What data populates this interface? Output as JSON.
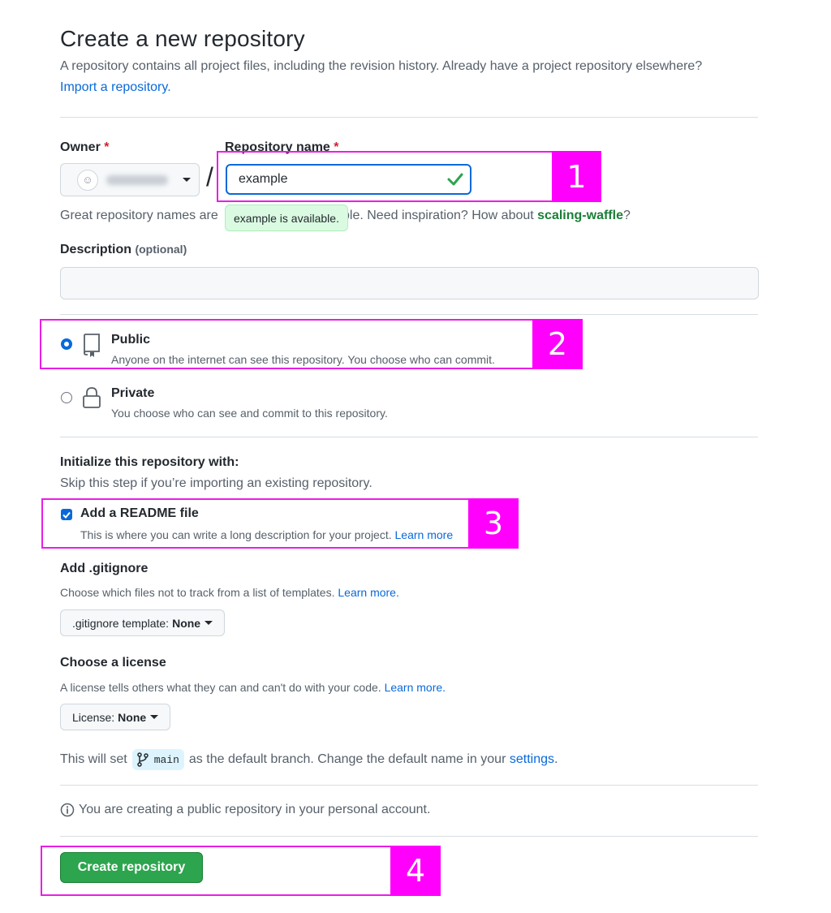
{
  "page": {
    "title": "Create a new repository",
    "subtitle": "A repository contains all project files, including the revision history. Already have a project repository elsewhere?",
    "import_link": "Import a repository."
  },
  "owner": {
    "label": "Owner",
    "required_mark": "*"
  },
  "repo_name": {
    "label": "Repository name",
    "required_mark": "*",
    "value": "example",
    "available_tooltip": "example is available.",
    "separator": "/"
  },
  "hint": {
    "prefix": "Great repository names are",
    "middle": "ple. Need inspiration? How about",
    "suggestion": "scaling-waffle",
    "suffix": "?"
  },
  "description": {
    "label": "Description",
    "optional": "(optional)",
    "value": ""
  },
  "visibility": {
    "public": {
      "title": "Public",
      "desc": "Anyone on the internet can see this repository. You choose who can commit.",
      "selected": true
    },
    "private": {
      "title": "Private",
      "desc": "You choose who can see and commit to this repository.",
      "selected": false
    }
  },
  "init": {
    "title": "Initialize this repository with:",
    "subtitle": "Skip this step if you’re importing an existing repository.",
    "readme": {
      "label": "Add a README file",
      "desc": "This is where you can write a long description for your project.",
      "link": "Learn more",
      "checked": true
    }
  },
  "gitignore": {
    "title": "Add .gitignore",
    "desc": "Choose which files not to track from a list of templates.",
    "link": "Learn more.",
    "button_prefix": ".gitignore template:",
    "button_value": "None"
  },
  "license": {
    "title": "Choose a license",
    "desc": "A license tells others what they can and can't do with your code.",
    "link": "Learn more.",
    "button_prefix": "License:",
    "button_value": "None"
  },
  "branch": {
    "prefix": "This will set",
    "name": "main",
    "middle": "as the default branch. Change the default name in your",
    "link": "settings",
    "suffix": "."
  },
  "info": {
    "text": "You are creating a public repository in your personal account."
  },
  "create_button": "Create repository",
  "annotations": [
    "1",
    "2",
    "3",
    "4"
  ],
  "colors": {
    "accent": "#0969da",
    "success": "#2da44e",
    "highlight": "#fe00fc"
  }
}
